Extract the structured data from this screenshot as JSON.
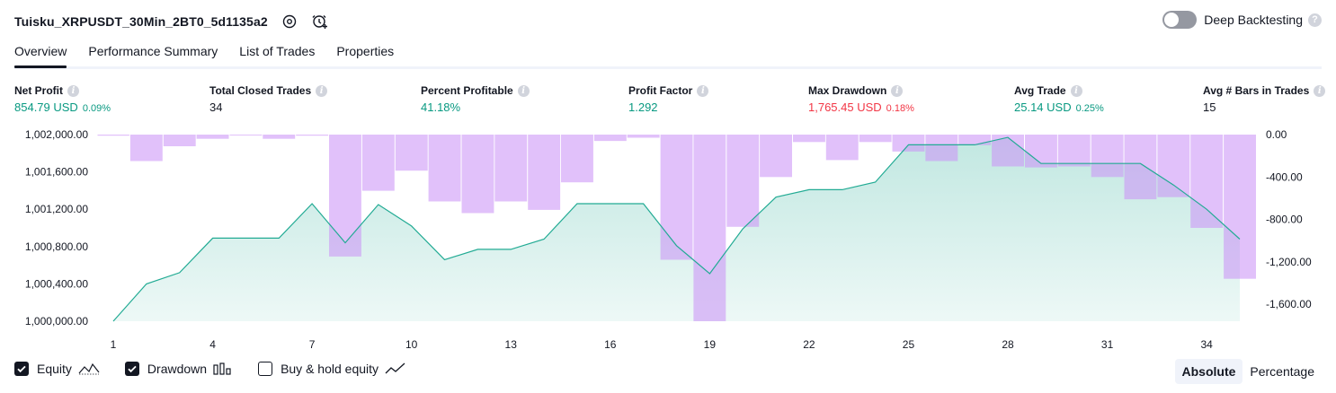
{
  "header": {
    "title": "Tuisku_XRPUSDT_30Min_2BT0_5d1135a2",
    "deep_backtesting_label": "Deep Backtesting",
    "deep_backtesting_enabled": false,
    "help_glyph": "?"
  },
  "tabs": [
    {
      "label": "Overview",
      "active": true
    },
    {
      "label": "Performance Summary",
      "active": false
    },
    {
      "label": "List of Trades",
      "active": false
    },
    {
      "label": "Properties",
      "active": false
    }
  ],
  "metrics": {
    "info_glyph": "i",
    "net_profit": {
      "label": "Net Profit",
      "value": "854.79 USD",
      "pct": "0.09%"
    },
    "total_closed_trades": {
      "label": "Total Closed Trades",
      "value": "34"
    },
    "percent_profitable": {
      "label": "Percent Profitable",
      "value": "41.18%"
    },
    "profit_factor": {
      "label": "Profit Factor",
      "value": "1.292"
    },
    "max_drawdown": {
      "label": "Max Drawdown",
      "value": "1,765.45 USD",
      "pct": "0.18%"
    },
    "avg_trade": {
      "label": "Avg Trade",
      "value": "25.14 USD",
      "pct": "0.25%"
    },
    "avg_bars": {
      "label": "Avg # Bars in Trades",
      "value": "15"
    }
  },
  "chart_data": {
    "type": "area",
    "x": [
      1,
      2,
      3,
      4,
      5,
      6,
      7,
      8,
      9,
      10,
      11,
      12,
      13,
      14,
      15,
      16,
      17,
      18,
      19,
      20,
      21,
      22,
      23,
      24,
      25,
      26,
      27,
      28,
      29,
      30,
      31,
      32,
      33,
      34,
      35
    ],
    "x_ticks": [
      1,
      4,
      7,
      10,
      13,
      16,
      19,
      22,
      25,
      28,
      31,
      34
    ],
    "left_axis": {
      "ticks": [
        "1,002,000.00",
        "1,001,600.00",
        "1,001,200.00",
        "1,000,800.00",
        "1,000,400.00",
        "1,000,000.00"
      ],
      "range": [
        1000000,
        1002000
      ]
    },
    "right_axis": {
      "ticks": [
        "0.00",
        "-400.00",
        "-800.00",
        "-1,200.00",
        "-1,600.00"
      ],
      "range": [
        -1760,
        0
      ]
    },
    "series": [
      {
        "name": "Equity",
        "axis": "left",
        "color": "#22ab94",
        "values": [
          1000000,
          1000400,
          1000520,
          1000890,
          1000890,
          1000890,
          1001260,
          1000840,
          1001250,
          1001020,
          1000660,
          1000770,
          1000770,
          1000880,
          1001260,
          1001260,
          1001260,
          1000810,
          1000510,
          1000990,
          1001330,
          1001410,
          1001410,
          1001490,
          1001890,
          1001890,
          1001890,
          1001970,
          1001690,
          1001690,
          1001690,
          1001690,
          1001460,
          1001200,
          1000880
        ]
      },
      {
        "name": "Drawdown",
        "axis": "right",
        "color": "#cc95f7",
        "values": [
          -10,
          -250,
          -110,
          -40,
          -5,
          -40,
          -10,
          -1150,
          -530,
          -340,
          -630,
          -740,
          -630,
          -710,
          -450,
          -60,
          -30,
          -1180,
          -1760,
          -870,
          -400,
          -70,
          -240,
          -70,
          -160,
          -250,
          -100,
          -300,
          -310,
          -300,
          -400,
          -610,
          -590,
          -880,
          -1360
        ]
      }
    ]
  },
  "legend": {
    "equity": {
      "label": "Equity",
      "checked": true
    },
    "drawdown": {
      "label": "Drawdown",
      "checked": true
    },
    "buy_hold": {
      "label": "Buy & hold equity",
      "checked": false
    }
  },
  "mode": {
    "absolute": "Absolute",
    "percentage": "Percentage",
    "active": "absolute"
  }
}
